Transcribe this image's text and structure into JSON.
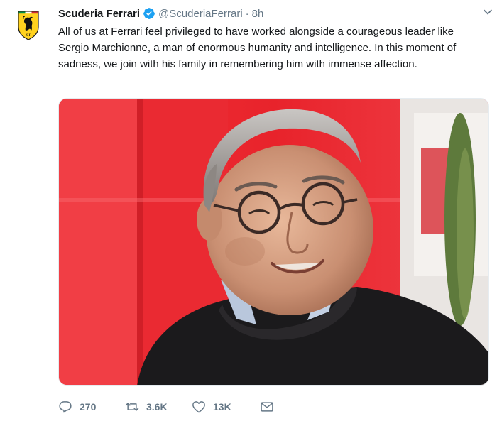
{
  "account": {
    "display_name": "Scuderia Ferrari",
    "screen_name": "@ScuderiaFerrari",
    "separator": "·",
    "time": "8h"
  },
  "tweet": {
    "text": "All of us at Ferrari feel privileged to have worked alongside a courageous leader like Sergio Marchionne, a man of enormous humanity and intelligence. In this moment of sadness, we join with his family in remembering him with immense affection."
  },
  "actions": {
    "reply_count": "270",
    "retweet_count": "3.6K",
    "like_count": "13K"
  },
  "colors": {
    "text_primary": "#14171a",
    "text_secondary": "#657786",
    "verified_blue": "#1da1f2",
    "ferrari_yellow": "#ffd21f",
    "ferrari_red": "#e8232b"
  },
  "icons": {
    "avatar": "ferrari-shield-logo",
    "verified": "verified-badge-icon",
    "caret": "chevron-down-icon",
    "reply": "reply-icon",
    "retweet": "retweet-icon",
    "like": "heart-icon",
    "dm": "envelope-icon"
  }
}
